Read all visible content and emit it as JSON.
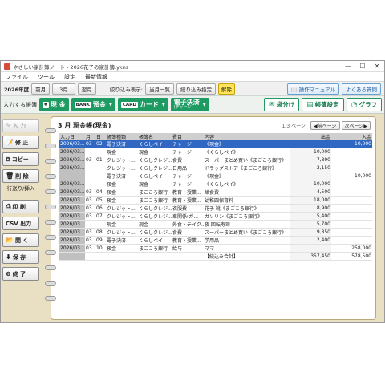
{
  "window": {
    "title": "やさしい家計簿ノート - 2026花子の家計簿.ykns",
    "controls": [
      "—",
      "☐",
      "✕"
    ]
  },
  "menu": [
    "ファイル",
    "ツール",
    "設定",
    "最新情報"
  ],
  "toolbar": {
    "year_label": "2026年度",
    "prev_month": "前月",
    "month_value": "3月",
    "next_month": "翌月",
    "filter_label": "絞り込み表示:",
    "filter_all": "当月一覧",
    "filter_specify": "絞り込み指定",
    "filter_clear": "解除",
    "manual": "操作マニュアル",
    "faq": "よくある質問"
  },
  "accounts_bar": {
    "label": "入力する帳簿",
    "cash": {
      "icon": "¥",
      "label": "現 金"
    },
    "bank": {
      "icon": "BANK",
      "label": "預金"
    },
    "card": {
      "icon": "CARD",
      "label": "カード"
    },
    "emoney": {
      "label": "電子決済",
      "sub": "(チャージ)"
    },
    "split": "袋分け",
    "settings": "帳簿設定",
    "graph": "グラフ"
  },
  "sidebar": {
    "input": "入 力",
    "edit": "修 正",
    "copy": "コピー",
    "delete": "削 除",
    "row_move": "行送り/挿入",
    "print": "印 刷",
    "csv": "CSV 出力",
    "open": "開 く",
    "save": "保 存",
    "exit": "終 了"
  },
  "ledger": {
    "title": "3 月  現金帳(現金)",
    "page_info": "1/3 ページ",
    "prev_page": "◀前ページ",
    "next_page": "次ページ▶",
    "columns": [
      "入力日",
      "月",
      "日",
      "帳簿種類",
      "帳簿名",
      "費目",
      "内容",
      "出金",
      "入金"
    ],
    "rows": [
      [
        "2026/03...",
        "03",
        "02",
        "電子決済",
        "くらしペイ",
        "チャージ",
        "《現金》",
        "",
        "10,000"
      ],
      [
        "2026/03...",
        "",
        "",
        "現金",
        "現金",
        "チャージ",
        "《くらしペイ》",
        "10,000",
        ""
      ],
      [
        "2026/03...",
        "03",
        "01",
        "クレジット...",
        "くらしクレジ...",
        "食費",
        "スーパーまとめ買い《まごころ銀行》",
        "7,890",
        ""
      ],
      [
        "2026/03...",
        "",
        "",
        "クレジット...",
        "くらしクレジ...",
        "日用品",
        "ドラッグストア《まごころ銀行》",
        "2,150",
        ""
      ],
      [
        "",
        "",
        "",
        "電子決済",
        "くらしペイ",
        "チャージ",
        "《現金》",
        "",
        "10,000"
      ],
      [
        "2026/03...",
        "",
        "",
        "預金",
        "現金",
        "チャージ",
        "《くらしペイ》",
        "10,000",
        ""
      ],
      [
        "2026/03...",
        "03",
        "04",
        "預金",
        "まごころ銀行",
        "教育・授業...",
        "給食費",
        "4,500",
        ""
      ],
      [
        "2026/03...",
        "03",
        "05",
        "預金",
        "まごころ銀行",
        "教育・授業...",
        "幼稚園保育料",
        "18,000",
        ""
      ],
      [
        "2026/03...",
        "03",
        "06",
        "クレジット...",
        "くらしクレジ...",
        "衣服費",
        "花子  靴《まごころ銀行》",
        "8,900",
        ""
      ],
      [
        "2026/03...",
        "03",
        "07",
        "クレジット...",
        "くらしクレジ...",
        "車関係(ガ...",
        "ガソリン《まごころ銀行》",
        "5,400",
        ""
      ],
      [
        "2026/03...",
        "",
        "",
        "現金",
        "現金",
        "外食・テイク...",
        "夜  回転寿司",
        "5,700",
        ""
      ],
      [
        "2026/03...",
        "03",
        "08",
        "クレジット...",
        "くらしクレジ...",
        "食費",
        "スーパーまとめ買い《まごころ銀行》",
        "9,850",
        ""
      ],
      [
        "2026/03...",
        "03",
        "09",
        "電子決済",
        "くらしペイ",
        "教育・授業...",
        "学用品",
        "2,400",
        ""
      ],
      [
        "2026/03...",
        "03",
        "10",
        "預金",
        "まごころ銀行",
        "給与",
        "ママ",
        "",
        "258,000"
      ],
      [
        "",
        "",
        "",
        "",
        "",
        "",
        "【絞込み合計】",
        "357,450",
        "578,500"
      ]
    ]
  }
}
